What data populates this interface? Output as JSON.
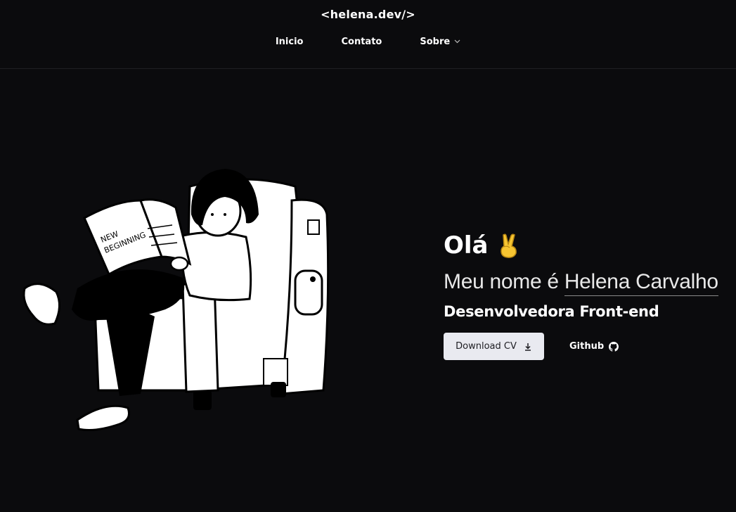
{
  "header": {
    "logo": "<helena.dev/>",
    "nav": [
      {
        "label": "Inicio"
      },
      {
        "label": "Contato"
      },
      {
        "label": "Sobre",
        "icon": "chevron-down-icon"
      }
    ]
  },
  "hero": {
    "greeting": "Olá",
    "greeting_icon": "victory-hand-icon",
    "intro_prefix": "Meu nome é",
    "name": "Helena Carvalho",
    "role": "Desenvolvedora Front-end",
    "download_label": "Download CV",
    "download_icon": "download-icon",
    "github_label": "Github",
    "github_icon": "github-icon"
  },
  "illustration": {
    "newspaper_text_line1": "NEW",
    "newspaper_text_line2": "BEGINNING"
  },
  "colors": {
    "background": "#0b0b0d",
    "text": "#ffffff",
    "button_bg": "#e9eaf0",
    "button_text": "#1d1d22",
    "emoji": "#f7c531"
  }
}
